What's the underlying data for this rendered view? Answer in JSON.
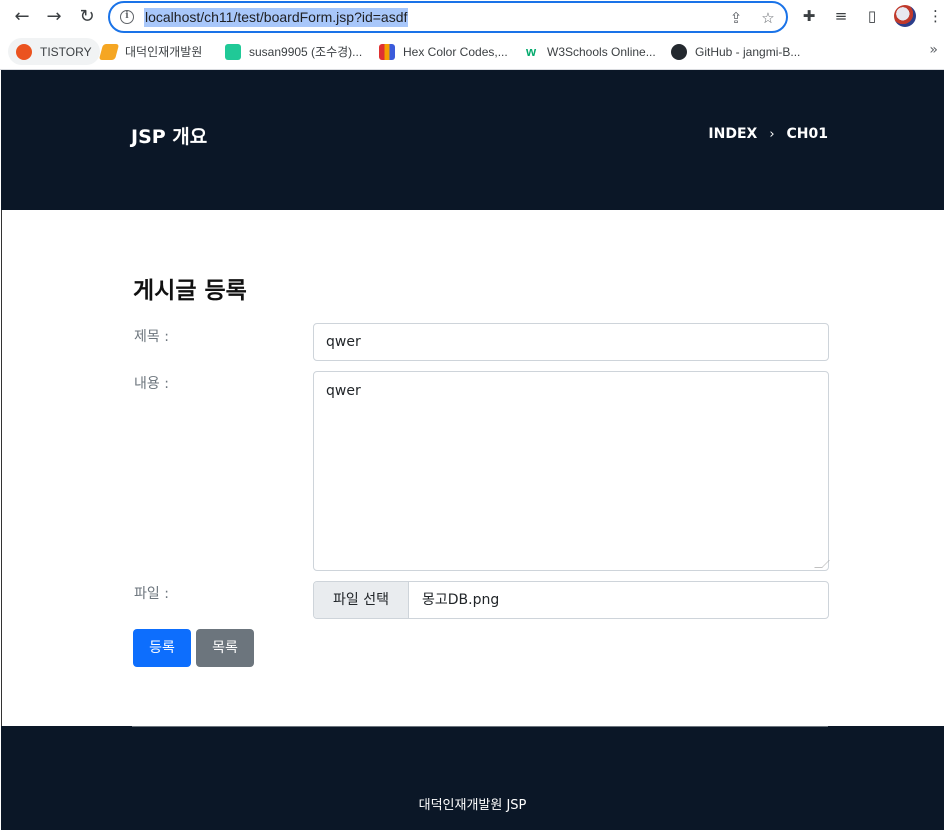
{
  "browser": {
    "url": "localhost/ch11/test/boardForm.jsp?id=asdf",
    "bookmarks": [
      {
        "label": "TISTORY",
        "color": "#eb531f"
      },
      {
        "label": "대덕인재개발원",
        "color": "#f5a623"
      },
      {
        "label": "susan9905 (조수경)...",
        "color": "#20c997"
      },
      {
        "label": "Hex Color Codes,...",
        "color": "#3b5bdb"
      },
      {
        "label": "W3Schools Online...",
        "color": "#04aa6d"
      },
      {
        "label": "GitHub - jangmi-B...",
        "color": "#24292f"
      }
    ],
    "more": "»"
  },
  "header": {
    "brand": "JSP 개요",
    "breadcrumb": [
      "INDEX",
      "CH01"
    ],
    "separator": "›"
  },
  "form": {
    "title": "게시글 등록",
    "subject_label": "제목 :",
    "subject_value": "qwer",
    "content_label": "내용 :",
    "content_value": "qwer",
    "file_label": "파일 :",
    "file_button": "파일 선택",
    "file_name": "몽고DB.png",
    "submit_label": "등록",
    "list_label": "목록"
  },
  "footer": {
    "text": "대덕인재개발원 JSP"
  },
  "colors": {
    "navy": "#0b1727",
    "primary": "#0d6efd",
    "secondary": "#6c757d"
  }
}
